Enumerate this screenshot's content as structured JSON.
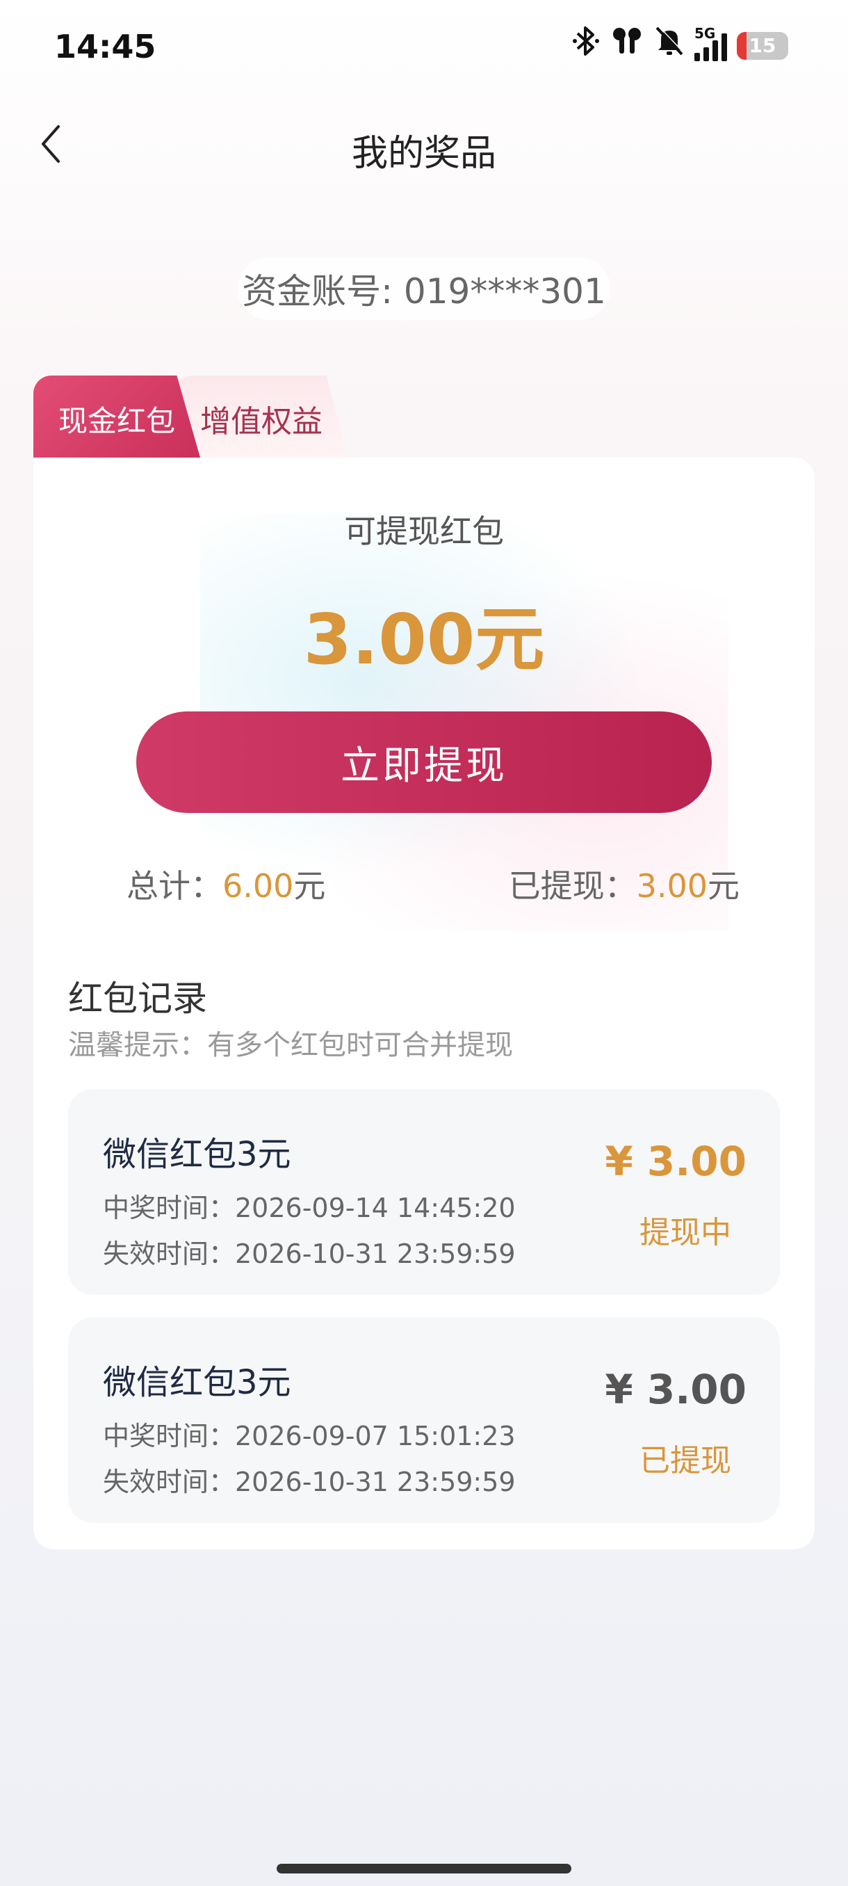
{
  "status_bar": {
    "time": "14:45",
    "icons": [
      "bluetooth-icon",
      "earbuds-icon",
      "mute-bell-icon",
      "signal-5g-icon"
    ],
    "network": "5G",
    "battery": "15"
  },
  "header": {
    "title": "我的奖品",
    "back_icon": "chevron-left-icon"
  },
  "account": {
    "label": "资金账号: 019****301"
  },
  "tabs": [
    {
      "label": "现金红包",
      "active": true
    },
    {
      "label": "增值权益",
      "active": false
    }
  ],
  "summary": {
    "withdrawable_label": "可提现红包",
    "amount": "3.00元",
    "withdraw_button": "立即提现",
    "total_label": "总计：",
    "total_value": "6.00",
    "withdrawn_label": "已提现：",
    "withdrawn_value": "3.00",
    "unit": "元"
  },
  "records": {
    "title": "红包记录",
    "tip": "温馨提示：有多个红包时可合并提现",
    "items": [
      {
        "name": "微信红包3元",
        "win_time": "中奖时间：2026-09-14 14:45:20",
        "expire_time": "失效时间：2026-10-31 23:59:59",
        "amount": "¥ 3.00",
        "status": "提现中"
      },
      {
        "name": "微信红包3元",
        "win_time": "中奖时间：2026-09-07 15:01:23",
        "expire_time": "失效时间：2026-10-31 23:59:59",
        "amount": "¥ 3.00",
        "status": "已提现"
      }
    ]
  },
  "colors": {
    "accent": "#c9305a",
    "gold": "#d9963a",
    "card": "#ffffff",
    "record_bg": "#f6f7f8"
  }
}
